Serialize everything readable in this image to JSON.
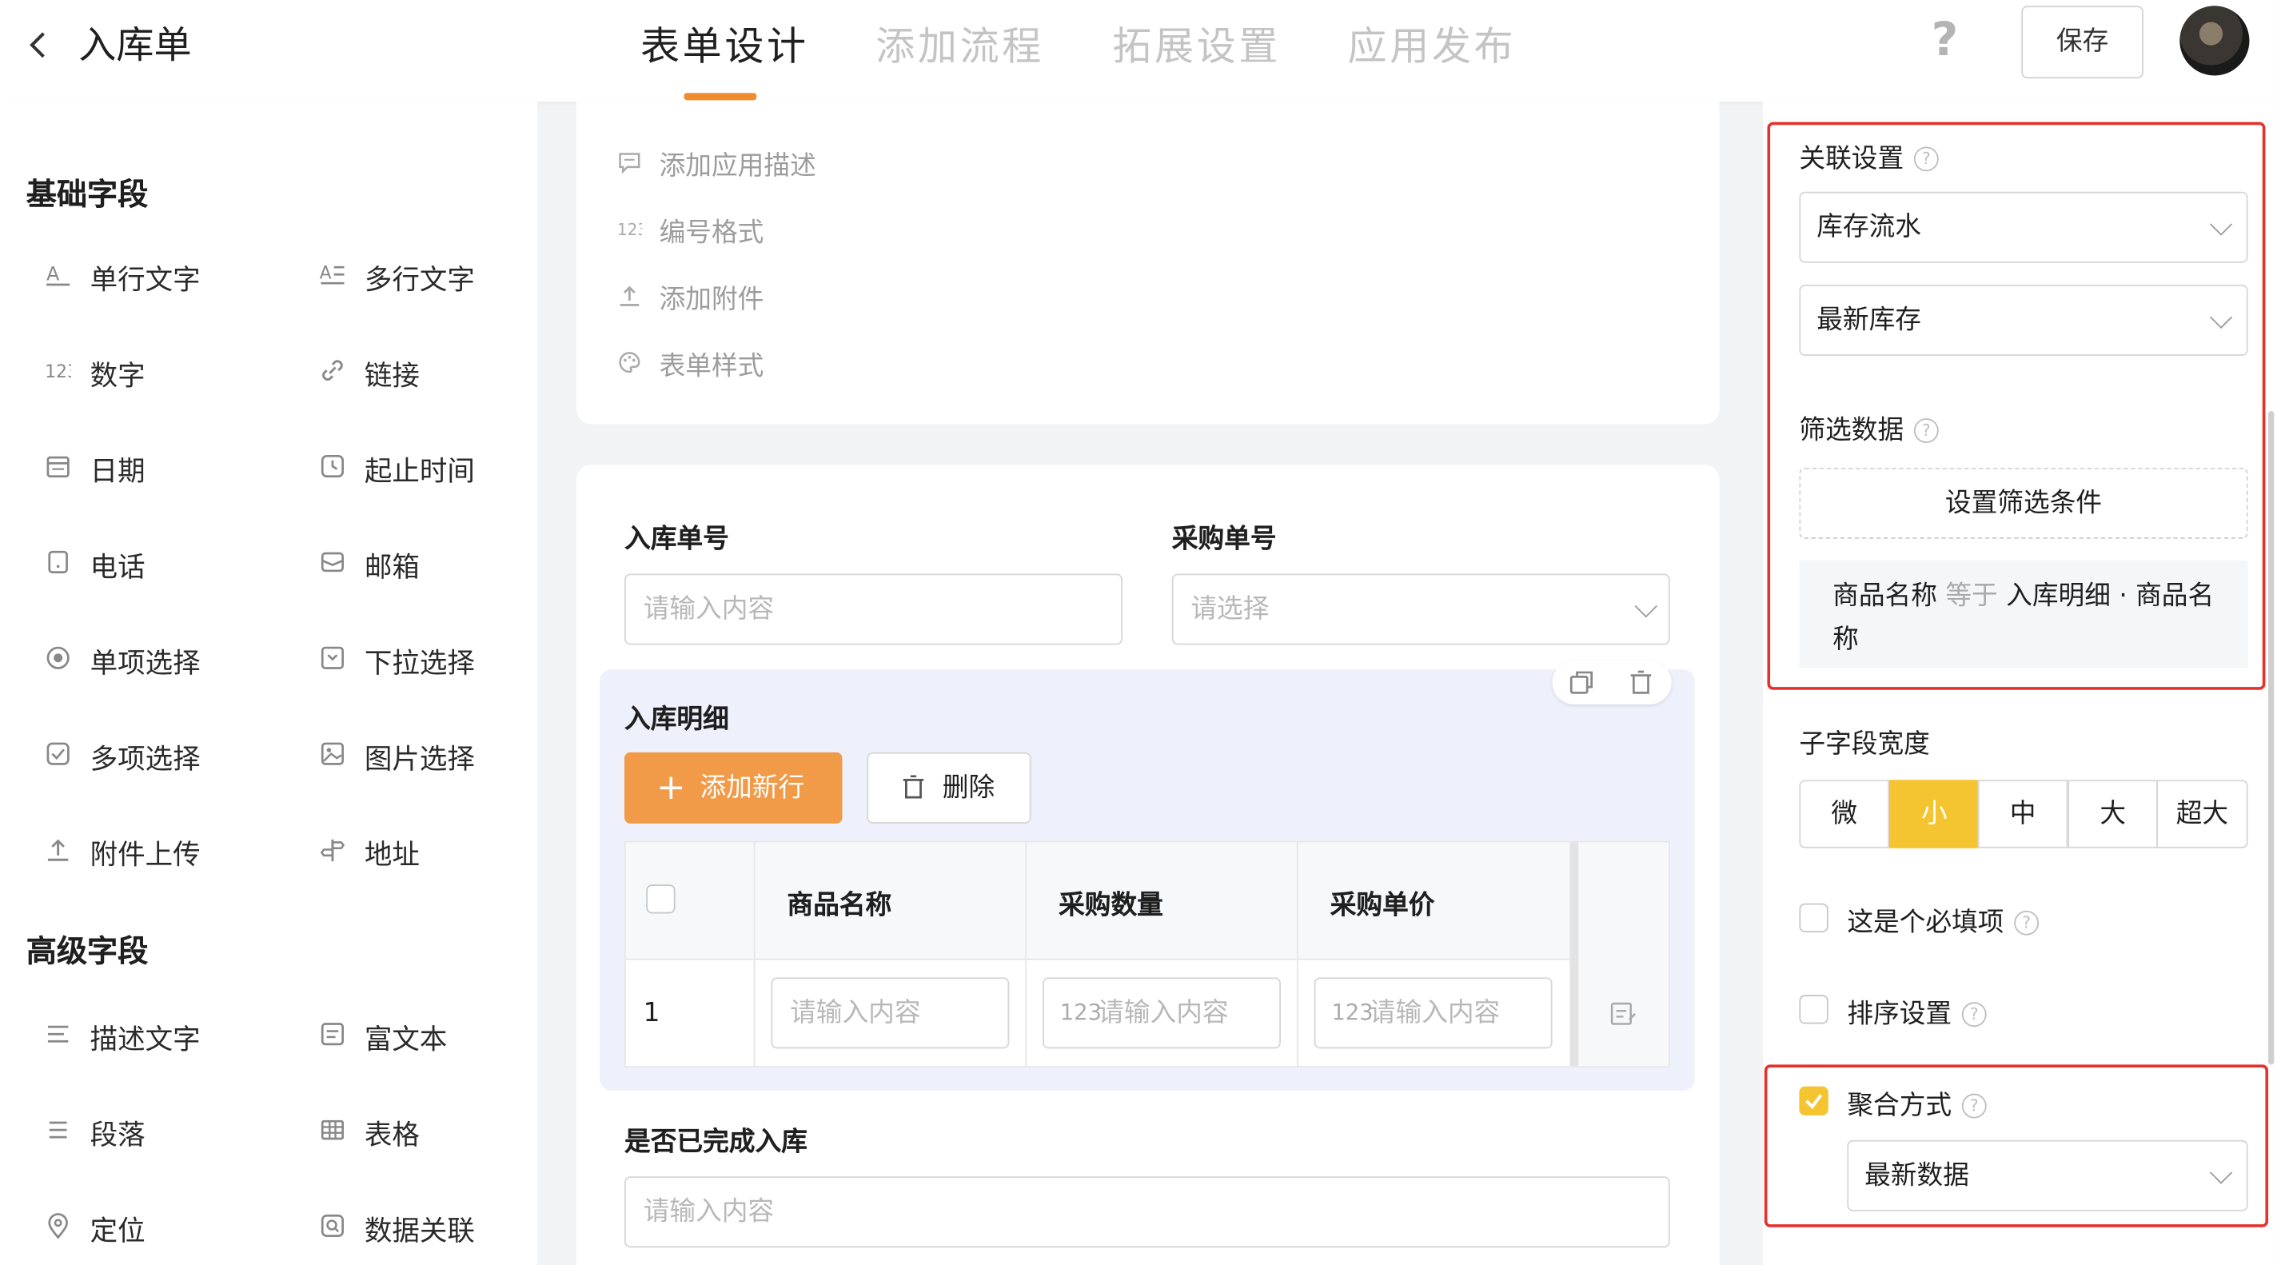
{
  "header": {
    "title": "入库单",
    "tabs": [
      "表单设计",
      "添加流程",
      "拓展设置",
      "应用发布"
    ],
    "help": "?",
    "save_label": "保存"
  },
  "left": {
    "basic_title": "基础字段",
    "basic_fields": [
      "单行文字",
      "多行文字",
      "数字",
      "链接",
      "日期",
      "起止时间",
      "电话",
      "邮箱",
      "单项选择",
      "下拉选择",
      "多项选择",
      "图片选择",
      "附件上传",
      "地址"
    ],
    "advanced_title": "高级字段",
    "advanced_fields": [
      "描述文字",
      "富文本",
      "段落",
      "表格",
      "定位",
      "数据关联"
    ]
  },
  "middle": {
    "options": [
      "添加应用描述",
      "编号格式",
      "添加附件",
      "表单样式"
    ],
    "field1_label": "入库单号",
    "field1_placeholder": "请输入内容",
    "field2_label": "采购单号",
    "field2_placeholder": "请选择",
    "subtable": {
      "title": "入库明细",
      "add_row": "添加新行",
      "delete": "删除",
      "columns": [
        "商品名称",
        "采购数量",
        "采购单价"
      ],
      "row_index": "1",
      "cell_placeholder": "请输入内容"
    },
    "field3_label": "是否已完成入库",
    "field3_placeholder": "请输入内容"
  },
  "right": {
    "relation_title": "关联设置",
    "relation_app": "库存流水",
    "relation_form": "最新库存",
    "filter_title": "筛选数据",
    "filter_button": "设置筛选条件",
    "filter_field": "商品名称",
    "filter_op": "等于",
    "filter_value": "入库明细 · 商品名称",
    "width_title": "子字段宽度",
    "width_options": [
      "微",
      "小",
      "中",
      "大",
      "超大"
    ],
    "width_selected": "小",
    "required_label": "这是个必填项",
    "sort_label": "排序设置",
    "aggregate_label": "聚合方式",
    "aggregate_value": "最新数据"
  },
  "colors": {
    "accent": "#f08c2e",
    "selected_segment": "#f5c431",
    "highlight_border": "#e5322d"
  }
}
